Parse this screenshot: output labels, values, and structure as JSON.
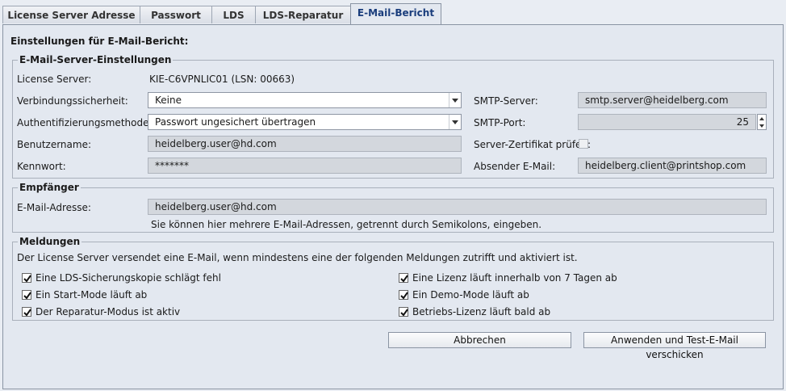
{
  "tabs": [
    "License Server Adresse",
    "Passwort",
    "LDS",
    "LDS-Reparatur",
    "E-Mail-Bericht"
  ],
  "active_tab": "E-Mail-Bericht",
  "page_heading": "Einstellungen für E-Mail-Bericht:",
  "server_group": {
    "legend": "E-Mail-Server-Einstellungen",
    "license_server_label": "License Server:",
    "license_server_value": "KIE-C6VPNLIC01 (LSN: 00663)",
    "security_label": "Verbindungssicherheit:",
    "security_value": "Keine",
    "auth_label": "Authentifizierungsmethode:",
    "auth_value": "Passwort ungesichert übertragen",
    "username_label": "Benutzername:",
    "username_value": "heidelberg.user@hd.com",
    "password_label": "Kennwort:",
    "password_value": "*******",
    "smtp_server_label": "SMTP-Server:",
    "smtp_server_value": "smtp.server@heidelberg.com",
    "smtp_port_label": "SMTP-Port:",
    "smtp_port_value": "25",
    "cert_label": "Server-Zertifikat prüfen:",
    "cert_checked": false,
    "sender_label": "Absender E-Mail:",
    "sender_value": "heidelberg.client@printshop.com"
  },
  "recipient_group": {
    "legend": "Empfänger",
    "email_label": "E-Mail-Adresse:",
    "email_value": "heidelberg.user@hd.com",
    "hint": "Sie können hier mehrere E-Mail-Adressen, getrennt durch Semikolons, eingeben."
  },
  "messages_group": {
    "legend": "Meldungen",
    "description": "Der License Server versendet eine E-Mail, wenn mindestens eine der folgenden Meldungen zutrifft und aktiviert ist.",
    "left_options": [
      {
        "label": "Eine LDS-Sicherungskopie schlägt fehl",
        "checked": true
      },
      {
        "label": "Ein Start-Mode läuft ab",
        "checked": true
      },
      {
        "label": "Der Reparatur-Modus ist aktiv",
        "checked": true
      }
    ],
    "right_options": [
      {
        "label": "Eine Lizenz läuft innerhalb von 7 Tagen ab",
        "checked": true
      },
      {
        "label": "Ein Demo-Mode läuft ab",
        "checked": true
      },
      {
        "label": "Betriebs-Lizenz läuft bald ab",
        "checked": true
      }
    ]
  },
  "buttons": {
    "cancel": "Abbrechen",
    "apply": "Anwenden und Test-E-Mail verschicken"
  },
  "colors": {
    "active_tab_text": "#1a3d7c",
    "panel_background": "#e3e8f0",
    "readonly_field": "#d3d7dd"
  }
}
